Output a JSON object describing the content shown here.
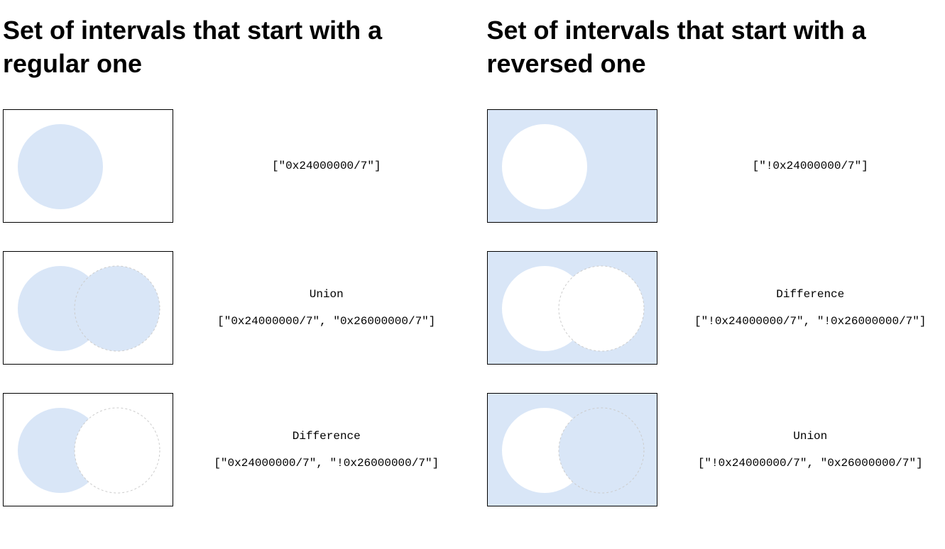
{
  "colors": {
    "fill": "#d9e6f7",
    "dash": "#cccccc",
    "border": "#000000"
  },
  "left": {
    "heading": "Set of intervals that start with a regular one",
    "rows": [
      {
        "op": "",
        "code": "[\"0x24000000/7\"]"
      },
      {
        "op": "Union",
        "code": "[\"0x24000000/7\", \"0x26000000/7\"]"
      },
      {
        "op": "Difference",
        "code": "[\"0x24000000/7\", \"!0x26000000/7\"]"
      }
    ]
  },
  "right": {
    "heading": "Set of intervals that start with a reversed one",
    "rows": [
      {
        "op": "",
        "code": "[\"!0x24000000/7\"]"
      },
      {
        "op": "Difference",
        "code": "[\"!0x24000000/7\", \"!0x26000000/7\"]"
      },
      {
        "op": "Union",
        "code": "[\"!0x24000000/7\", \"0x26000000/7\"]"
      }
    ]
  }
}
